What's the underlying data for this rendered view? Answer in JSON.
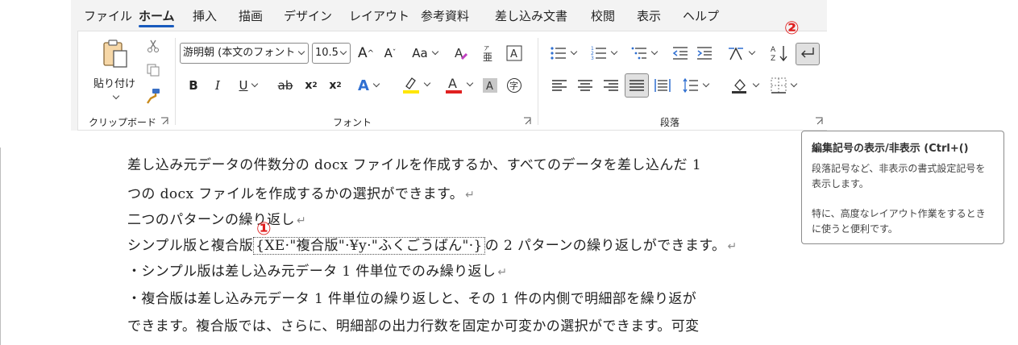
{
  "tabs": [
    {
      "label": "ファイル",
      "active": false
    },
    {
      "label": "ホーム",
      "active": true
    },
    {
      "label": "挿入",
      "active": false
    },
    {
      "label": "描画",
      "active": false
    },
    {
      "label": "デザイン",
      "active": false
    },
    {
      "label": "レイアウト",
      "active": false
    },
    {
      "label": "参考資料",
      "active": false
    },
    {
      "label": "差し込み文書",
      "active": false
    },
    {
      "label": "校閲",
      "active": false
    },
    {
      "label": "表示",
      "active": false
    },
    {
      "label": "ヘルプ",
      "active": false
    }
  ],
  "clipboard": {
    "paste_label": "貼り付け",
    "group_label": "クリップボード"
  },
  "font": {
    "name": "游明朝 (本文のフォント",
    "size": "10.5",
    "group_label": "フォント",
    "change_case": "Aa"
  },
  "paragraph": {
    "group_label": "段落"
  },
  "markers": {
    "one": "①",
    "two": "②"
  },
  "document": {
    "lines": [
      "差し込み元データの件数分の docx ファイルを作成するか、すべてのデータを差し込んだ 1",
      "つの docx ファイルを作成するかの選択ができます。",
      "二つのパターンの繰り返し",
      "シンプル版と複合版",
      "・シンプル版は差し込み元データ 1 件単位でのみ繰り返し",
      "・複合版は差し込み元データ 1 件単位の繰り返しと、その 1 件の内側で明細部を繰り返が",
      "できます。複合版では、さらに、明細部の出力行数を固定か可変かの選択ができます。可変"
    ],
    "field_code": "XE·\"複合版\"·¥y·\"ふくごうばん\"·",
    "line4_after": "の 2 パターンの繰り返しができます。"
  },
  "tooltip": {
    "title": "編集記号の表示/非表示 (Ctrl+()",
    "body1": "段落記号など、非表示の書式設定記号を表示します。",
    "body2": "特に、高度なレイアウト作業をするときに使うと便利です。"
  },
  "colors": {
    "accent": "#185abd",
    "marker": "#e02020",
    "highlight": "#ffe600",
    "font_color": "#e02020"
  }
}
